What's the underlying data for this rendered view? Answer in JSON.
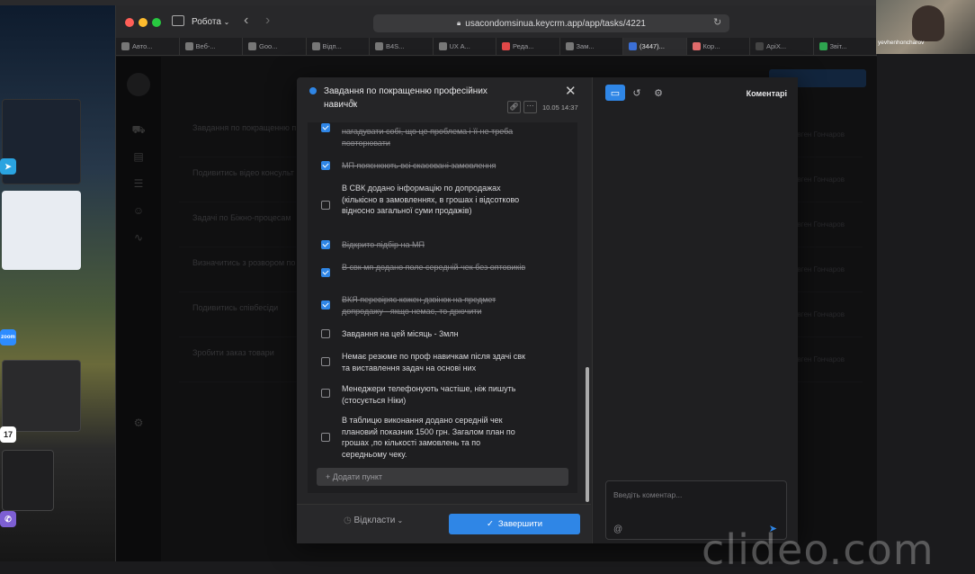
{
  "browser": {
    "profile_label": "Робота",
    "url": "usacondomsinua.keycrm.app/app/tasks/4221",
    "tabs": [
      {
        "label": "Авто..."
      },
      {
        "label": "Веб-..."
      },
      {
        "label": "Goo..."
      },
      {
        "label": "Відп..."
      },
      {
        "label": "B4S..."
      },
      {
        "label": "UX A..."
      },
      {
        "label": "Реда..."
      },
      {
        "label": "Зам..."
      },
      {
        "label": "(3447)..."
      },
      {
        "label": "Кор..."
      },
      {
        "label": "ApiX..."
      },
      {
        "label": "Звіт..."
      }
    ]
  },
  "background_app": {
    "rows": [
      {
        "title": "Завдання по покращенню п",
        "assignee": "Євген Гончаров"
      },
      {
        "title": "Подивитись відео консульт",
        "assignee": "Євген Гончаров"
      },
      {
        "title": "Задачі по Біжно-процесам",
        "assignee": "Євген Гончаров"
      },
      {
        "title": "Визначитись з розвором по",
        "assignee": "Євген Гончаров"
      },
      {
        "title": "Подивитись співбесіди",
        "assignee": "Євген Гончаров"
      },
      {
        "title": "Зробити заказ товари",
        "assignee": "Євген Гончаров"
      }
    ]
  },
  "modal": {
    "title": "Завдання по покращенню професійних навичок",
    "timestamp": "10.05 14:37",
    "checklist": [
      {
        "text": "нагадувати собі, що це проблема і її не треба повторювати",
        "done": true
      },
      {
        "text": "МП пояснюють всі скасовані замовлення",
        "done": true
      },
      {
        "text": "В СВК додано інформацію по допродажах (кількісно в замовленнях, в грошах і відсотково відносно загальної суми продажів)",
        "done": false
      },
      {
        "text": "Відкрито підбір на МП",
        "done": true
      },
      {
        "text": "В свк мп додано поле середній чек без оптовиків",
        "done": true
      },
      {
        "text": "ВКЯ перевіряє кожен дзвінок на предмет допродажу - якщо немає, то дрючити",
        "done": true
      },
      {
        "text": "Завдання на цей місяць - 3млн",
        "done": false
      },
      {
        "text": "Немає резюме по проф навичкам після здачі свк та виставлення задач на основі них",
        "done": false
      },
      {
        "text": "Менеджери телефонують частіше, ніж пишуть (стосується Ніки)",
        "done": false
      },
      {
        "text": "В таблицю виконання додано середній чек плановий показник 1500 грн. Загалом план по грошах ,по кількості замовлень та по середньому чеку.",
        "done": false
      }
    ],
    "add_item_label": "+ Додати пункт",
    "postpone_label": "Відкласти",
    "complete_label": "Завершити",
    "comments_heading": "Коментарі",
    "comment_placeholder": "Введіть коментар..."
  },
  "video": {
    "name": "yevhenhoncharov"
  },
  "watermark": "clideo.com",
  "colors": {
    "accent": "#2f86e6"
  }
}
